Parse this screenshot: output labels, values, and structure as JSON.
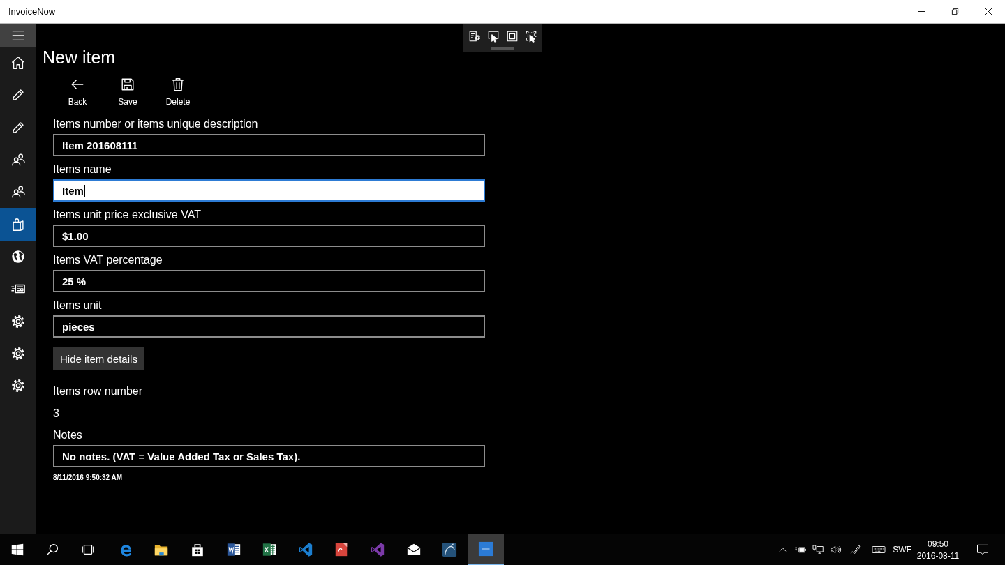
{
  "window": {
    "title": "InvoiceNow"
  },
  "nav": {
    "items": [
      {
        "selected": false
      },
      {
        "selected": false
      },
      {
        "selected": false
      },
      {
        "selected": false
      },
      {
        "selected": false
      },
      {
        "selected": true
      },
      {
        "selected": false
      },
      {
        "selected": false
      },
      {
        "selected": false
      },
      {
        "selected": false
      },
      {
        "selected": false
      }
    ]
  },
  "page": {
    "title": "New item",
    "commands": [
      {
        "label": "Back"
      },
      {
        "label": "Save"
      },
      {
        "label": "Delete"
      }
    ]
  },
  "form": {
    "fields": [
      {
        "label": "Items number or items unique description",
        "value": "Item 201608111",
        "focused": false
      },
      {
        "label": "Items name",
        "value": "Item",
        "focused": true
      },
      {
        "label": "Items unit price exclusive VAT",
        "value": "$1.00",
        "focused": false
      },
      {
        "label": "Items VAT percentage",
        "value": "25 %",
        "focused": false
      },
      {
        "label": "Items unit",
        "value": "pieces",
        "focused": false
      }
    ],
    "toggle_button": "Hide item details",
    "row_number": {
      "label": "Items row number",
      "value": "3"
    },
    "notes": {
      "label": "Notes",
      "value": "No notes. (VAT = Value Added Tax or Sales Tax).",
      "focused": false
    },
    "timestamp": "8/11/2016 9:50:32 AM"
  },
  "taskbar": {
    "apps": [
      {
        "selected": false
      },
      {
        "selected": false
      },
      {
        "selected": false
      },
      {
        "selected": false
      },
      {
        "selected": false
      },
      {
        "selected": false
      },
      {
        "selected": false
      },
      {
        "selected": false
      },
      {
        "selected": false
      },
      {
        "selected": false
      },
      {
        "selected": true
      }
    ],
    "tray": {
      "language": "SWE",
      "time": "09:50",
      "date": "2016-08-11"
    }
  }
}
